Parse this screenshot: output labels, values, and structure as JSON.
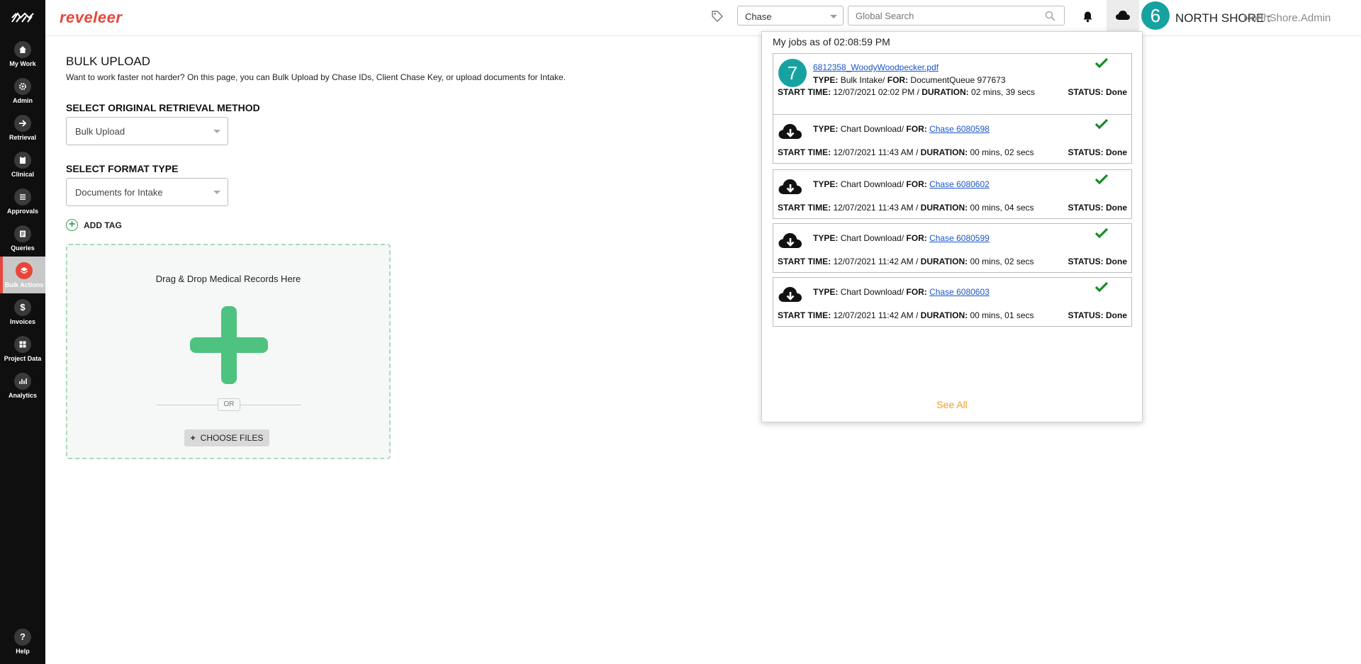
{
  "sidebar": {
    "items": [
      {
        "label": "My Work",
        "icon": "house-icon"
      },
      {
        "label": "Admin",
        "icon": "gear-icon"
      },
      {
        "label": "Retrieval",
        "icon": "arrow-right-icon"
      },
      {
        "label": "Clinical",
        "icon": "clipboard-icon"
      },
      {
        "label": "Approvals",
        "icon": "list-icon"
      },
      {
        "label": "Queries",
        "icon": "document-icon"
      },
      {
        "label": "Bulk Actions",
        "icon": "layers-icon"
      },
      {
        "label": "Invoices",
        "icon": "dollar-icon"
      },
      {
        "label": "Project Data",
        "icon": "grid-icon"
      },
      {
        "label": "Analytics",
        "icon": "bar-chart-icon"
      }
    ],
    "help_label": "Help"
  },
  "header": {
    "brand": "reveleer",
    "search_type": "Chase",
    "search_placeholder": "Global Search",
    "org": "NORTH SHORE :",
    "user": "NorthShore.Admin",
    "callout_6": "6"
  },
  "page": {
    "title": "BULK UPLOAD",
    "description": "Want to work faster not harder? On this page, you can Bulk Upload by Chase IDs, Client Chase Key, or upload documents for Intake.",
    "retrieval_label": "SELECT ORIGINAL RETRIEVAL METHOD",
    "retrieval_value": "Bulk Upload",
    "format_label": "SELECT FORMAT TYPE",
    "format_value": "Documents for Intake",
    "add_tag": "ADD TAG",
    "dropzone_title": "Drag & Drop Medical Records Here",
    "or": "OR",
    "choose_files": "CHOOSE FILES"
  },
  "jobs": {
    "title": "My jobs as of 02:08:59 PM",
    "callout_7": "7",
    "items": [
      {
        "file": "6812358_WoodyWoodpecker.pdf",
        "type": "Bulk Intake/",
        "for_text": "DocumentQueue 977673",
        "start": "12/07/2021 02:02 PM /",
        "duration": "02 mins, 39 secs",
        "status": "Done"
      },
      {
        "type": "Chart Download/",
        "for_link": "Chase 6080598",
        "start": "12/07/2021 11:43 AM /",
        "duration": "00 mins, 02 secs",
        "status": "Done"
      },
      {
        "type": "Chart Download/",
        "for_link": "Chase 6080602",
        "start": "12/07/2021 11:43 AM /",
        "duration": "00 mins, 04 secs",
        "status": "Done"
      },
      {
        "type": "Chart Download/",
        "for_link": "Chase 6080599",
        "start": "12/07/2021 11:42 AM /",
        "duration": "00 mins, 02 secs",
        "status": "Done"
      },
      {
        "type": "Chart Download/",
        "for_link": "Chase 6080603",
        "start": "12/07/2021 11:42 AM /",
        "duration": "00 mins, 01 secs",
        "status": "Done"
      }
    ],
    "labels": {
      "type": "TYPE:",
      "for": "FOR:",
      "start": "START TIME:",
      "duration": "DURATION:",
      "status": "STATUS:"
    },
    "see_all": "See All"
  },
  "colors": {
    "brand": "#e8463a",
    "accent": "#17a2a2",
    "success": "#1a8a2a",
    "link": "#1a56c8",
    "see_all": "#f0a020"
  }
}
